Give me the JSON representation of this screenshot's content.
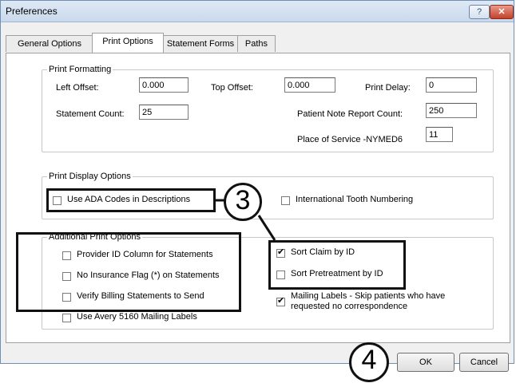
{
  "window": {
    "title": "Preferences",
    "help_label": "?",
    "close_label": "✕"
  },
  "tabs": [
    "General Options",
    "Print Options",
    "Statement Forms",
    "Paths"
  ],
  "print_formatting": {
    "legend": "Print Formatting",
    "left_offset_label": "Left Offset:",
    "left_offset_value": "0.000",
    "top_offset_label": "Top Offset:",
    "top_offset_value": "0.000",
    "print_delay_label": "Print Delay:",
    "print_delay_value": "0",
    "statement_count_label": "Statement Count:",
    "statement_count_value": "25",
    "patient_note_label": "Patient Note Report Count:",
    "patient_note_value": "250",
    "place_of_service_label": "Place of Service -NYMED6",
    "place_of_service_value": "11"
  },
  "print_display": {
    "legend": "Print Display Options",
    "ada_codes": {
      "label": "Use ADA Codes in Descriptions",
      "checked": false
    },
    "intl_tooth": {
      "label": "International Tooth Numbering",
      "checked": false
    }
  },
  "additional": {
    "legend": "Additional Print Options",
    "provider_id": {
      "label": "Provider ID Column for Statements",
      "checked": false
    },
    "no_insurance": {
      "label": "No Insurance Flag (*) on Statements",
      "checked": false
    },
    "verify_billing": {
      "label": "Verify Billing Statements to Send",
      "checked": false
    },
    "use_avery": {
      "label": "Use Avery 5160 Mailing Labels",
      "checked": false
    },
    "sort_claim": {
      "label": "Sort Claim by ID",
      "checked": true
    },
    "sort_pretreatment": {
      "label": "Sort Pretreatment by ID",
      "checked": false
    },
    "mailing_labels": {
      "label_line1": "Mailing Labels - Skip patients who have",
      "label_line2": "requested no correspondence",
      "checked": true
    }
  },
  "callouts": {
    "step3": "3",
    "step4": "4"
  },
  "buttons": {
    "ok": "OK",
    "cancel": "Cancel"
  }
}
